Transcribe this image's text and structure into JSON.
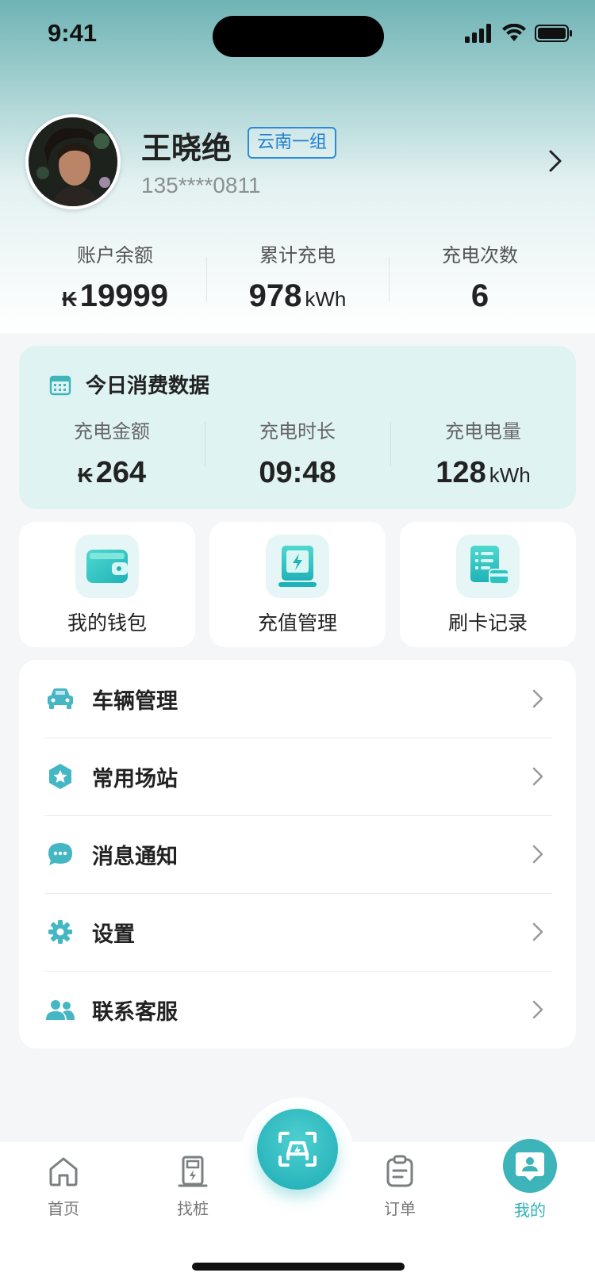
{
  "status_bar": {
    "time": "9:41"
  },
  "profile": {
    "name": "王晓绝",
    "group": "云南一组",
    "phone": "135****0811"
  },
  "stats": [
    {
      "label": "账户余额",
      "prefix": "₭",
      "value": "19999",
      "unit": ""
    },
    {
      "label": "累计充电",
      "prefix": "",
      "value": "978",
      "unit": "kWh"
    },
    {
      "label": "充电次数",
      "prefix": "",
      "value": "6",
      "unit": ""
    }
  ],
  "today": {
    "title": "今日消费数据",
    "items": [
      {
        "label": "充电金额",
        "prefix": "₭",
        "value": "264",
        "unit": ""
      },
      {
        "label": "充电时长",
        "prefix": "",
        "value": "09:48",
        "unit": ""
      },
      {
        "label": "充电电量",
        "prefix": "",
        "value": "128",
        "unit": "kWh"
      }
    ]
  },
  "quick_actions": [
    {
      "label": "我的钱包",
      "icon": "wallet-icon"
    },
    {
      "label": "充值管理",
      "icon": "charger-icon"
    },
    {
      "label": "刷卡记录",
      "icon": "card-record-icon"
    }
  ],
  "menu": [
    {
      "label": "车辆管理",
      "icon": "car-icon"
    },
    {
      "label": "常用场站",
      "icon": "star-station-icon"
    },
    {
      "label": "消息通知",
      "icon": "message-icon"
    },
    {
      "label": "设置",
      "icon": "gear-icon"
    },
    {
      "label": "联系客服",
      "icon": "users-icon"
    }
  ],
  "tabs": [
    {
      "label": "首页",
      "icon": "home-icon",
      "active": false
    },
    {
      "label": "找桩",
      "icon": "find-pile-icon",
      "active": false
    },
    {
      "label": "订单",
      "icon": "order-icon",
      "active": false
    },
    {
      "label": "我的",
      "icon": "profile-icon",
      "active": true
    }
  ],
  "colors": {
    "accent": "#2fb2ba",
    "badge": "#1f7fd0",
    "card_bg": "#e0f3f3"
  }
}
